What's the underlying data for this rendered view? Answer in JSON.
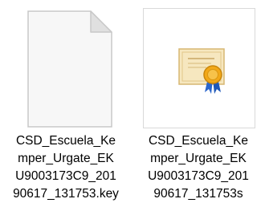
{
  "files": [
    {
      "icon": "blank-document-icon",
      "name_lines": [
        "CSD_Escuela_Ke",
        "mper_Urgate_EK",
        "U9003173C9_201",
        "90617_131753.key"
      ]
    },
    {
      "icon": "certificate-icon",
      "name_lines": [
        "CSD_Escuela_Ke",
        "mper_Urgate_EK",
        "U9003173C9_201",
        "90617_131753s"
      ]
    }
  ],
  "colors": {
    "page_fold": "#d4d4d4",
    "page_body": "#f9f9f9",
    "certificate_paper": "#f3e1b3",
    "certificate_seal": "#f0a81c",
    "ribbon": "#2d6ed6"
  }
}
